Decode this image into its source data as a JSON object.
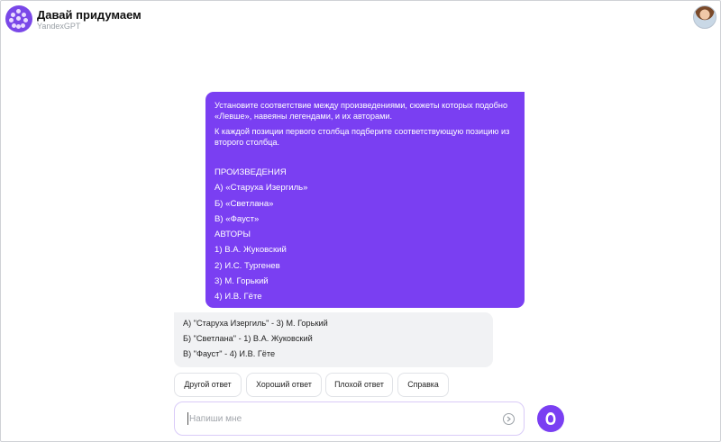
{
  "header": {
    "title": "Давай придумаем",
    "subtitle": "YandexGPT",
    "logo_icon": "app-logo-icon",
    "avatar_icon": "user-avatar"
  },
  "user_message": {
    "para1": "Установите соответствие между произведениями, сюжеты которых подобно «Левше», навеяны легендами, и их авторами.",
    "para2": "К каждой позиции первого столбца подберите соответствующую позицию из второго столбца.",
    "heading_works": "ПРОИЗВЕДЕНИЯ",
    "works": [
      "А) «Старуха Изергиль»",
      "Б) «Светлана»",
      "В) «Фауст»"
    ],
    "heading_authors": "АВТОРЫ",
    "authors": [
      "1) В.А. Жуковский",
      "2) И.С. Тургенев",
      "3) М. Горький",
      "4) И.В. Гёте"
    ]
  },
  "bot_message": {
    "rows": [
      "А) \"Старуха Изергиль\" - 3) М. Горький",
      "Б) \"Светлана\" - 1) В.А. Жуковский",
      "В) \"Фауст\" - 4) И.В. Гёте"
    ]
  },
  "actions": {
    "other": "Другой ответ",
    "good": "Хороший ответ",
    "bad": "Плохой ответ",
    "help": "Справка"
  },
  "input": {
    "placeholder": "Напиши мне",
    "value": ""
  },
  "colors": {
    "accent": "#7a3ff2",
    "bot_bubble": "#f1f2f4"
  }
}
